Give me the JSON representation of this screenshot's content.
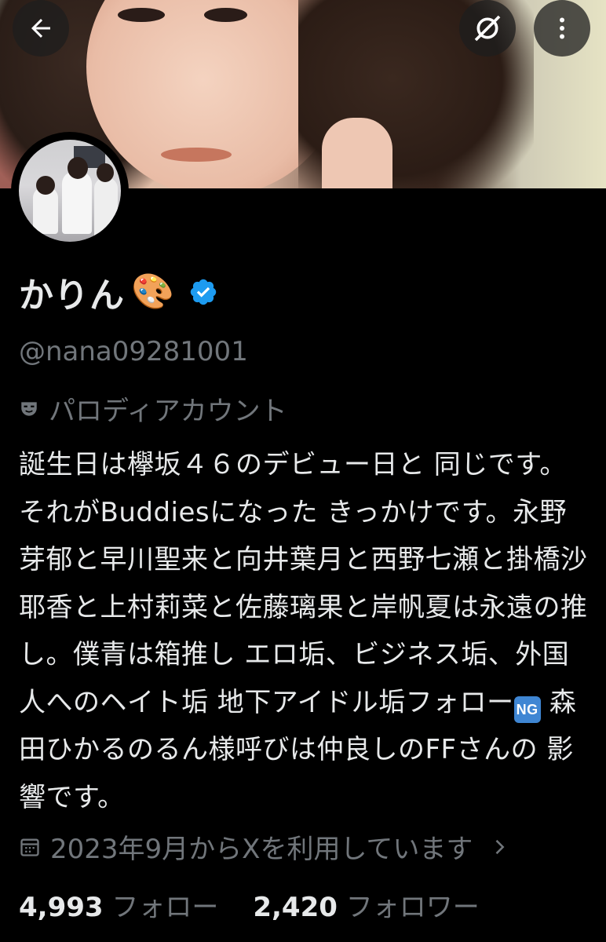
{
  "profile": {
    "display_name": "かりん",
    "name_emoji": "🎨",
    "verified_icon": "verified-badge-icon",
    "handle": "@nana09281001",
    "parody_label": "パロディアカウント",
    "bio_parts": {
      "before_ng": "誕生日は欅坂４６のデビュー日と 同じです。それがBuddiesになった きっかけです。永野芽郁と早川聖来と向井葉月と西野七瀬と掛橋沙耶香と上村莉菜と佐藤璃果と岸帆夏は永遠の推し。僕青は箱推し エロ垢、ビジネス垢、外国人へのヘイト垢 地下アイドル垢フォロー",
      "ng_badge": "NG",
      "after_ng": " 森田ひかるのるん様呼びは仲良しのFFさんの 影響です。"
    },
    "joined_text": "2023年9月からXを利用しています",
    "following_count": "4,993",
    "following_label": "フォロー",
    "followers_count": "2,420",
    "followers_label": "フォロワー"
  },
  "colors": {
    "background": "#000000",
    "text_primary": "#e7e9ea",
    "text_secondary": "#71767b",
    "verified_blue": "#1d9bf0"
  },
  "icons": {
    "back": "back-arrow-icon",
    "grok": "grok-icon",
    "more": "more-vertical-icon",
    "parody": "theater-mask-icon",
    "calendar": "calendar-icon",
    "chevron": "chevron-right-icon"
  }
}
